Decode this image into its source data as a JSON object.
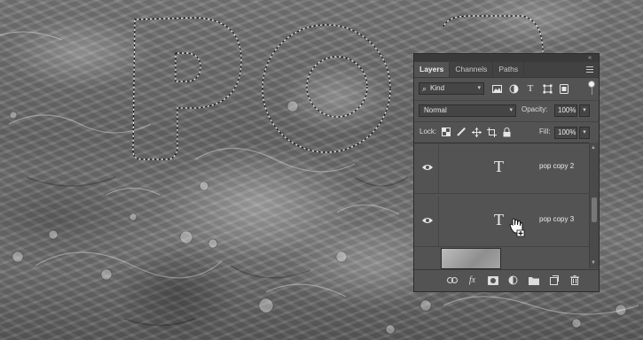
{
  "canvas": {
    "selection_text": "pop"
  },
  "panel": {
    "tabs": [
      {
        "label": "Layers",
        "active": true
      },
      {
        "label": "Channels",
        "active": false
      },
      {
        "label": "Paths",
        "active": false
      }
    ],
    "collapse_glyph": "«",
    "filter": {
      "kind_label": "Kind",
      "icons": [
        "image-filter-icon",
        "adjustment-filter-icon",
        "type-filter-icon",
        "shape-filter-icon",
        "smart-object-filter-icon"
      ]
    },
    "blend": {
      "mode": "Normal",
      "opacity_label": "Opacity:",
      "opacity_value": "100%"
    },
    "lock": {
      "label": "Lock:",
      "fill_label": "Fill:",
      "fill_value": "100%"
    },
    "layers": [
      {
        "name": "pop copy 2",
        "type_glyph": "T",
        "visible": true
      },
      {
        "name": "pop copy 3",
        "type_glyph": "T",
        "visible": true
      }
    ]
  }
}
